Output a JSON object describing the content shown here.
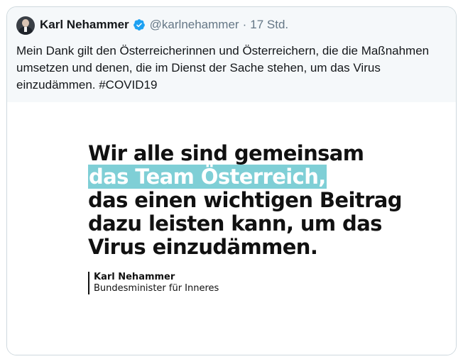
{
  "tweet": {
    "author_name": "Karl Nehammer",
    "handle": "@karlnehammer",
    "separator": "·",
    "time": "17 Std.",
    "text": "Mein Dank gilt den Österreicherinnen und Österreichern, die die Maßnahmen umsetzen und denen, die im Dienst der Sache stehen, um das Virus einzudämmen. #COVID19",
    "verified_icon": "verified-badge-icon",
    "verified_color": "#1da1f2"
  },
  "media": {
    "quote_line_1": "Wir alle sind gemeinsam",
    "quote_line_2": "das Team Österreich,",
    "quote_line_3": "das einen wichtigen Beitrag",
    "quote_line_4": "dazu leisten kann, um das",
    "quote_line_5": "Virus einzudämmen.",
    "signature_name": "Karl Nehammer",
    "signature_title": "Bundesminister für Inneres",
    "highlight_color": "#7fcfd6"
  }
}
